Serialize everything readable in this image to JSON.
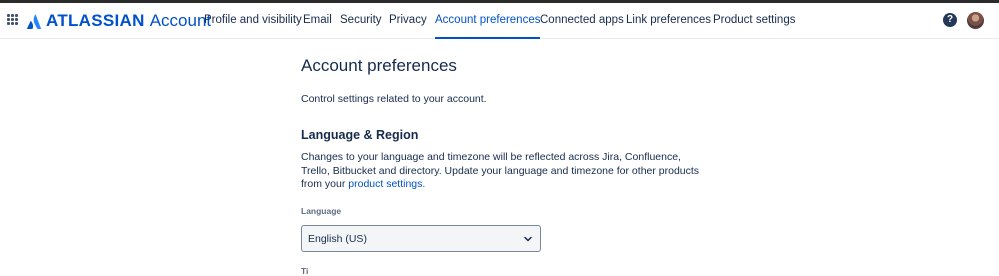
{
  "brand": {
    "name": "ATLASSIAN",
    "product": "Account"
  },
  "nav": {
    "items": [
      {
        "label": "Profile and visibility"
      },
      {
        "label": "Email"
      },
      {
        "label": "Security"
      },
      {
        "label": "Privacy"
      },
      {
        "label": "Account preferences",
        "active": true
      },
      {
        "label": "Connected apps"
      },
      {
        "label": "Link preferences"
      },
      {
        "label": "Product settings"
      }
    ],
    "help_icon": "?"
  },
  "page": {
    "title": "Account preferences",
    "intro": "Control settings related to your account."
  },
  "language_region": {
    "title": "Language & Region",
    "description": "Changes to your language and timezone will be reflected across Jira, Confluence, Trello, Bitbucket and directory. Update your language and timezone for other products from your",
    "link_text": "product settings.",
    "language_label": "Language",
    "language_value": "English (US)",
    "next_label": "Ti"
  },
  "colors": {
    "accent": "#0052CC",
    "text": "#172B4D",
    "muted": "#5E6C84"
  },
  "icons": [
    "app-switcher-icon",
    "atlassian-logo-icon",
    "help-icon",
    "chevron-down-icon",
    "avatar"
  ]
}
